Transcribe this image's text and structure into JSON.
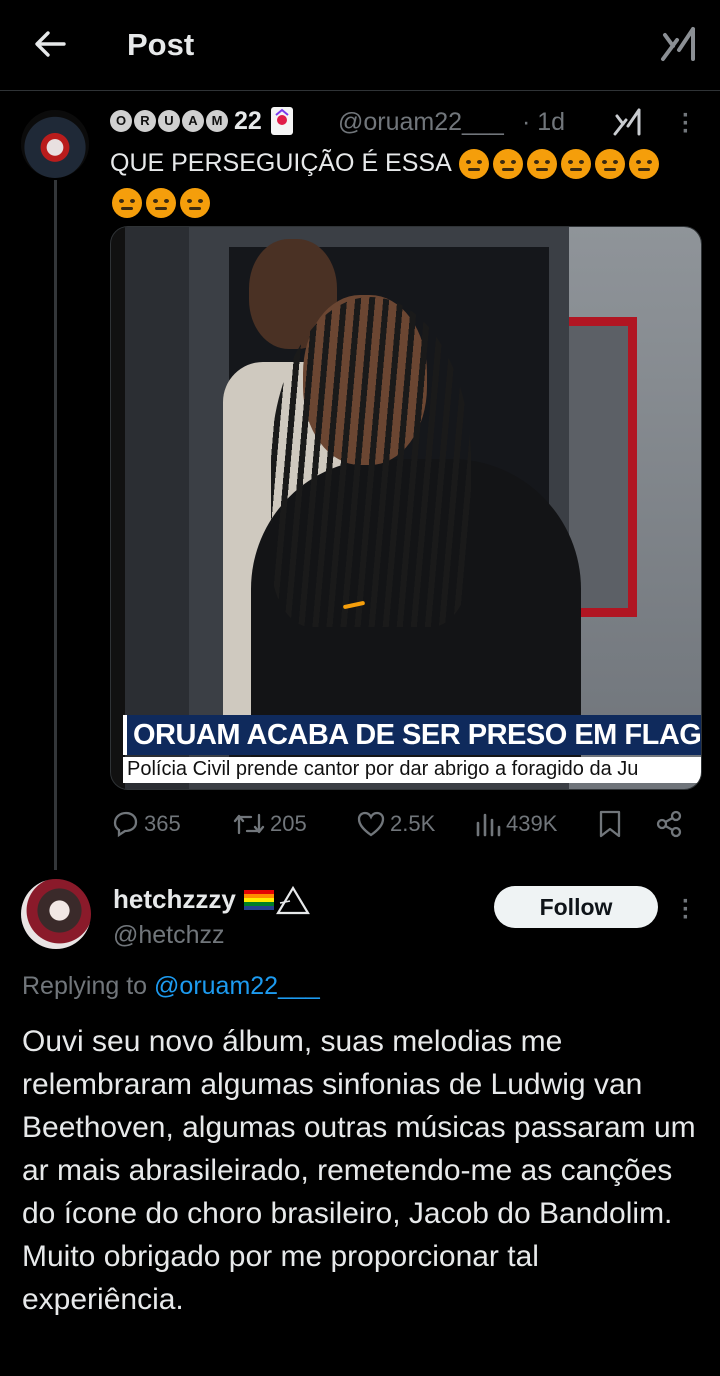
{
  "header": {
    "title": "Post"
  },
  "post": {
    "author_letters": [
      "O",
      "R",
      "U",
      "A",
      "M"
    ],
    "author_suffix": "22",
    "handle": "@oruam22___",
    "time": "· 1d",
    "text": "QUE PERSEGUIÇÃO É ESSA",
    "emoji_count": 9,
    "media": {
      "headline": "ORUAM ACABA DE SER PRESO EM FLAGR",
      "subheadline": "Polícia Civil prende cantor por dar abrigo a foragido da Ju"
    },
    "stats": {
      "replies": "365",
      "reposts": "205",
      "likes": "2.5K",
      "views": "439K"
    }
  },
  "reply": {
    "name": "hetchzzzy",
    "handle": "@hetchzz",
    "follow_label": "Follow",
    "replying_prefix": "Replying to",
    "replying_handle": "@oruam22___",
    "text": "Ouvi seu novo álbum, suas melodias me relembraram algumas sinfonias de Ludwig van Beethoven, algumas outras músicas passaram um ar mais abrasileirado, remetendo-me as canções do ícone do choro brasileiro, Jacob do Bandolim. Muito obrigado por me proporcionar tal experiência."
  },
  "colors": {
    "background": "#000000",
    "text": "#e7e9ea",
    "muted": "#71767b",
    "link": "#1d9bf0",
    "angry_emoji": "#f59e0b"
  },
  "icons": [
    "back-arrow-icon",
    "grok-icon",
    "more-icon",
    "reply-icon",
    "repost-icon",
    "like-icon",
    "views-icon",
    "bookmark-icon",
    "share-icon",
    "rainbow-flag-icon",
    "triangle-icon",
    "joker-card-icon"
  ]
}
